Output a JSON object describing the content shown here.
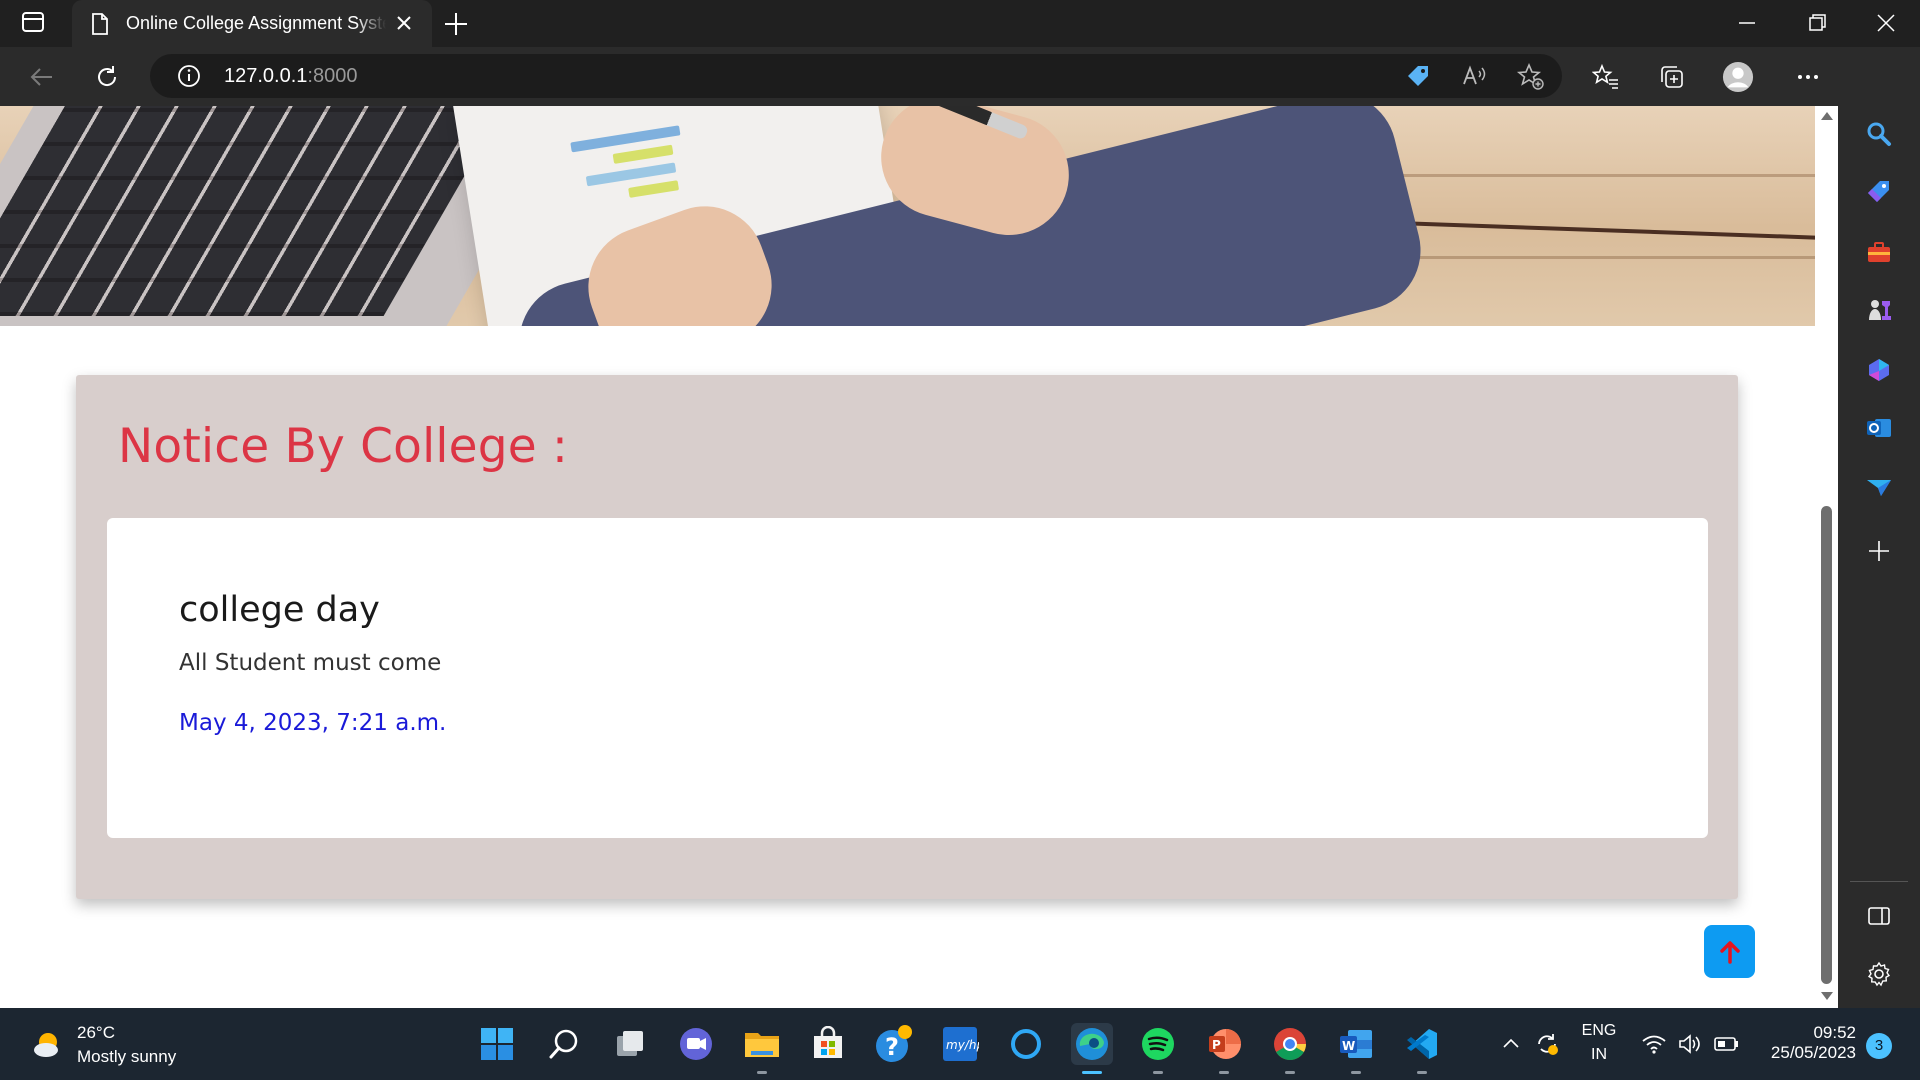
{
  "browser": {
    "tab_title": "Online College Assignment System",
    "url_host": "127.0.0.1",
    "url_port": ":8000"
  },
  "page": {
    "notice_heading": "Notice By College :",
    "notices": [
      {
        "title": "college day",
        "body": "All Student must come",
        "date": "May 4, 2023, 7:21 a.m."
      }
    ],
    "scroll_top_icon": "arrow-up-icon"
  },
  "sidebar": {
    "items": [
      "search-icon",
      "shopping-tag-icon",
      "tools-icon",
      "games-icon",
      "copilot-icon",
      "outlook-icon",
      "send-icon",
      "add-icon"
    ],
    "bottom": [
      "sidebar-panel-icon",
      "settings-icon"
    ]
  },
  "taskbar": {
    "weather_temp": "26°C",
    "weather_desc": "Mostly sunny",
    "apps": [
      "start",
      "search",
      "task-view",
      "teams-chat",
      "file-explorer",
      "microsoft-store",
      "get-help",
      "myhp",
      "cortana",
      "edge",
      "spotify",
      "powerpoint",
      "chrome",
      "word",
      "vscode"
    ],
    "lang_line1": "ENG",
    "lang_line2": "IN",
    "time": "09:52",
    "date": "25/05/2023",
    "notification_count": "3"
  },
  "colors": {
    "heading_red": "#dc3545",
    "date_blue": "#1a1ad8",
    "panel_bg": "#d8cecc",
    "scroll_button": "#0d9bf2"
  }
}
